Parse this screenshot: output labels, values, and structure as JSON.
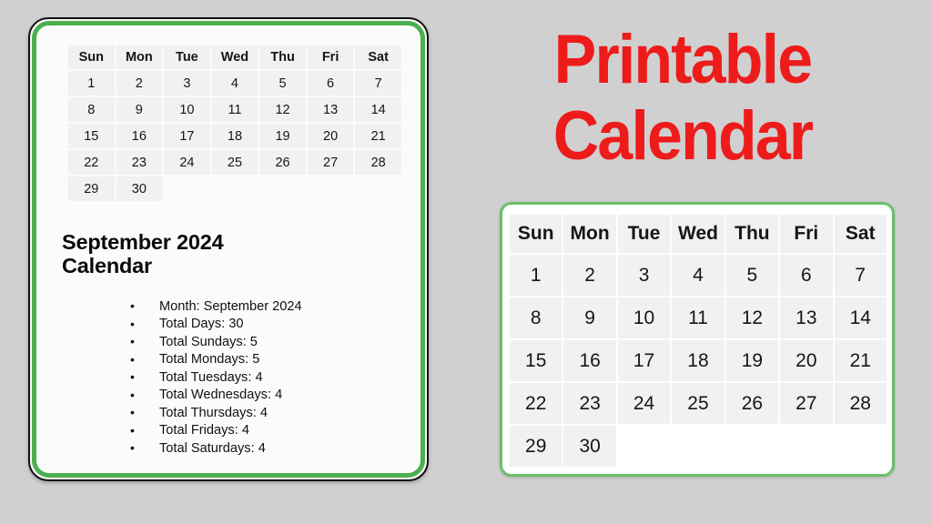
{
  "background_color": "#d0d0d0",
  "title": {
    "line1": "Printable",
    "line2": "Calendar",
    "color": "#ee1b1b"
  },
  "left_card": {
    "border_outer_color": "#111111",
    "border_inner_color": "#4caf50",
    "background": "#fbfbfb",
    "heading": "September 2024 Calendar",
    "details": [
      "Month: September 2024",
      "Total Days: 30",
      "Total Sundays: 5",
      "Total Mondays: 5",
      "Total Tuesdays: 4",
      "Total Wednesdays: 4",
      "Total Thursdays: 4",
      "Total Fridays: 4",
      "Total Saturdays: 4"
    ]
  },
  "right_card": {
    "border_color": "#6abf69",
    "background": "#ffffff"
  },
  "calendar": {
    "month": "September",
    "year": "2024",
    "weekday_headers": [
      "Sun",
      "Mon",
      "Tue",
      "Wed",
      "Thu",
      "Fri",
      "Sat"
    ],
    "weeks": [
      [
        "1",
        "2",
        "3",
        "4",
        "5",
        "6",
        "7"
      ],
      [
        "8",
        "9",
        "10",
        "11",
        "12",
        "13",
        "14"
      ],
      [
        "15",
        "16",
        "17",
        "18",
        "19",
        "20",
        "21"
      ],
      [
        "22",
        "23",
        "24",
        "25",
        "26",
        "27",
        "28"
      ],
      [
        "29",
        "30",
        "",
        "",
        "",
        "",
        ""
      ]
    ]
  }
}
